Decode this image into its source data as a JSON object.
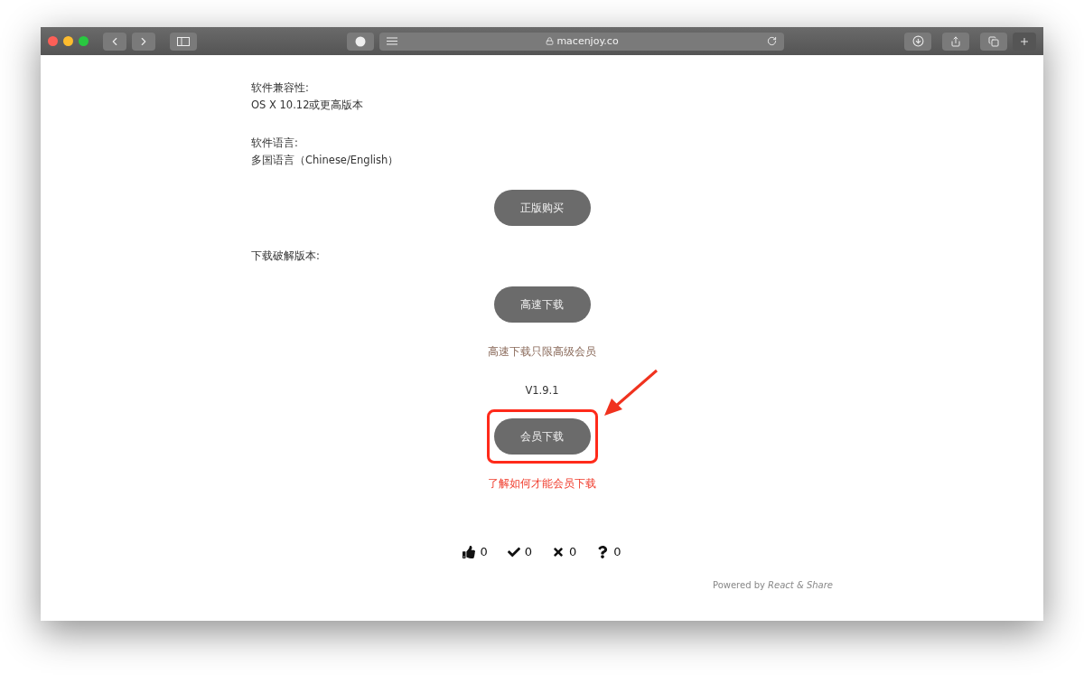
{
  "browser": {
    "address": "macenjoy.co"
  },
  "info": [
    {
      "label": "软件兼容性:",
      "value": "OS X 10.12或更高版本"
    },
    {
      "label": "软件语言:",
      "value": "多国语言（Chinese/English）"
    }
  ],
  "buy_button": "正版购买",
  "download_label": "下载破解版本:",
  "fast_download_button": "高速下载",
  "fast_download_note": "高速下载只限高级会员",
  "version": "V1.9.1",
  "member_download_button": "会员下载",
  "member_link": "了解如何才能会员下载",
  "reactions": [
    {
      "kind": "like",
      "count": "0"
    },
    {
      "kind": "check",
      "count": "0"
    },
    {
      "kind": "cross",
      "count": "0"
    },
    {
      "kind": "question",
      "count": "0"
    }
  ],
  "powered_by": "Powered by *React & Share*"
}
